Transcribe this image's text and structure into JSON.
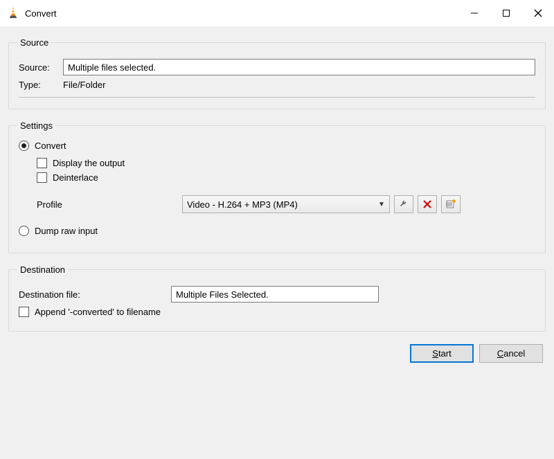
{
  "window": {
    "title": "Convert"
  },
  "source": {
    "legend": "Source",
    "source_label": "Source:",
    "source_value": "Multiple files selected.",
    "type_label": "Type:",
    "type_value": "File/Folder"
  },
  "settings": {
    "legend": "Settings",
    "convert_label": "Convert",
    "display_output_label": "Display the output",
    "deinterlace_label": "Deinterlace",
    "profile_label": "Profile",
    "profile_value": "Video - H.264 + MP3 (MP4)",
    "dump_label": "Dump raw input"
  },
  "destination": {
    "legend": "Destination",
    "file_label": "Destination file:",
    "file_value": "Multiple Files Selected.",
    "append_label": "Append '-converted' to filename"
  },
  "buttons": {
    "start_prefix": "S",
    "start_rest": "tart",
    "cancel_prefix": "C",
    "cancel_rest": "ancel"
  }
}
